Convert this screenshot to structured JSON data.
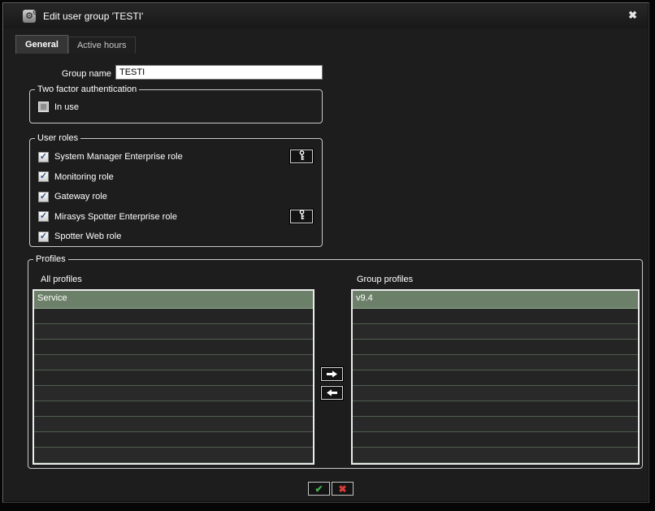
{
  "window": {
    "title": "Edit user group 'TESTI'",
    "icon_glyph": "⚙",
    "close_glyph": "✖"
  },
  "tabs": [
    {
      "label": "General",
      "active": true
    },
    {
      "label": "Active hours",
      "active": false
    }
  ],
  "form": {
    "group_name_label": "Group name",
    "group_name_value": "TESTI"
  },
  "two_factor": {
    "legend": "Two factor authentication",
    "checkbox_label": "In use",
    "checked": false
  },
  "user_roles": {
    "legend": "User roles",
    "items": [
      {
        "label": "System Manager Enterprise role",
        "checked": true,
        "has_key_button": true
      },
      {
        "label": "Monitoring role",
        "checked": true,
        "has_key_button": false
      },
      {
        "label": "Gateway role",
        "checked": true,
        "has_key_button": false
      },
      {
        "label": "Mirasys Spotter Enterprise role",
        "checked": true,
        "has_key_button": true
      },
      {
        "label": "Spotter Web role",
        "checked": true,
        "has_key_button": false
      }
    ],
    "check_glyph": "✓"
  },
  "profiles": {
    "legend": "Profiles",
    "all_profiles_label": "All profiles",
    "group_profiles_label": "Group profiles",
    "all_profiles": [
      {
        "name": "Service",
        "selected": true
      }
    ],
    "group_profiles": [
      {
        "name": "v9.4",
        "selected": true
      }
    ],
    "empty_row_count": 10
  },
  "footer": {
    "ok_glyph": "✔",
    "cancel_glyph": "✖"
  },
  "colors": {
    "selected_row": "#6c8069",
    "row_separator": "#505e50",
    "checkmark_blue": "#35548a",
    "ok_green": "#45b14f",
    "cancel_red": "#dd3b3b"
  }
}
